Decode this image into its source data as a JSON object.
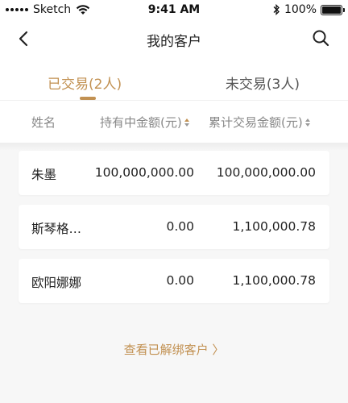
{
  "status_bar": {
    "carrier": "Sketch",
    "time": "9:41 AM",
    "battery": "100%"
  },
  "nav": {
    "title": "我的客户",
    "back_icon": "chevron-left-icon",
    "search_icon": "search-icon"
  },
  "tabs": [
    {
      "label": "已交易(2人)",
      "active": true
    },
    {
      "label": "未交易(3人)",
      "active": false
    }
  ],
  "accent_color": "#c29152",
  "columns": {
    "name": "姓名",
    "holding": "持有中金额(元)",
    "total": "累计交易金额(元)"
  },
  "rows": [
    {
      "name": "朱墨",
      "holding": "100,000,000.00",
      "total": "100,000,000.00"
    },
    {
      "name": "斯琴格…",
      "holding": "0.00",
      "total": "1,100,000.78"
    },
    {
      "name": "欧阳娜娜",
      "holding": "0.00",
      "total": "1,100,000.78"
    }
  ],
  "footer_link": "查看已解绑客户 〉"
}
